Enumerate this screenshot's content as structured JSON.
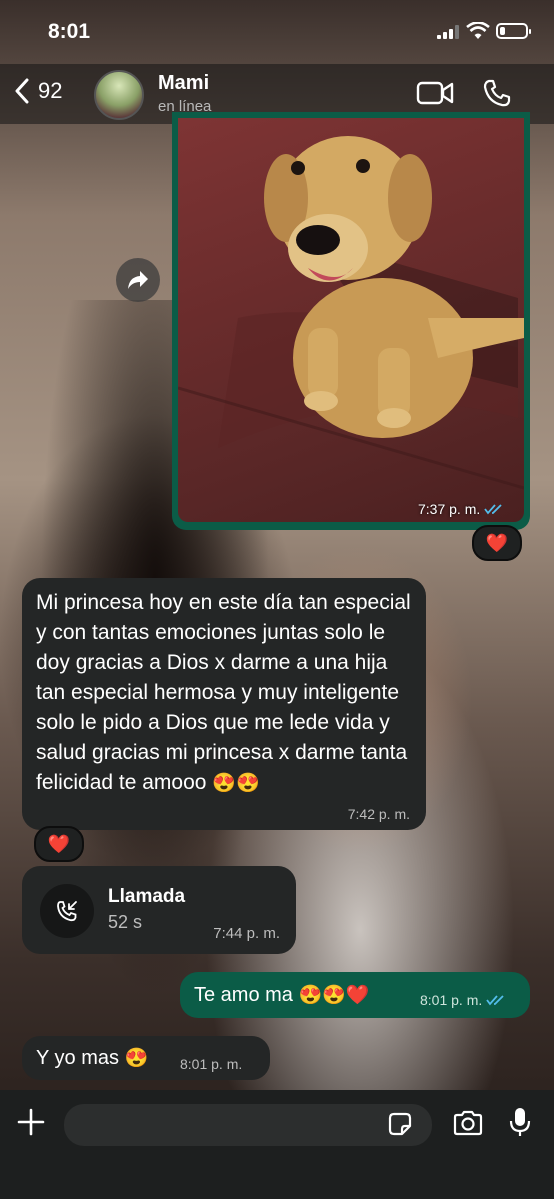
{
  "status_bar": {
    "time": "8:01"
  },
  "header": {
    "back_count": "92",
    "contact_name": "Mami",
    "contact_status": "en línea"
  },
  "messages": {
    "image": {
      "time": "7:37 p. m.",
      "reaction": "❤️"
    },
    "text1": {
      "text": "Mi princesa hoy en este día tan especial y con tantas emociones juntas solo le doy gracias a Dios x darme a una hija tan especial hermosa y muy inteligente solo le pido a Dios que me lede vida y salud gracias mi princesa x darme tanta felicidad te amooo",
      "emoji": "😍😍",
      "time": "7:42 p. m.",
      "reaction": "❤️"
    },
    "call": {
      "title": "Llamada",
      "duration": "52 s",
      "time": "7:44 p. m."
    },
    "outgoing": {
      "text": "Te amo ma",
      "emoji": "😍😍❤️",
      "time": "8:01 p. m."
    },
    "last": {
      "text": "Y yo mas",
      "emoji": "😍",
      "time": "8:01 p. m."
    }
  },
  "input": {
    "placeholder": ""
  },
  "colors": {
    "incoming": "#242626",
    "outgoing": "#0b5c47",
    "read_ticks": "#53bdeb",
    "heart": "#e0162b"
  },
  "icons": [
    "chevron-left-icon",
    "video-icon",
    "phone-icon",
    "forward-icon",
    "missed-call-icon",
    "plus-icon",
    "sticker-icon",
    "camera-icon",
    "mic-icon",
    "heart-icon",
    "double-check-icon"
  ]
}
